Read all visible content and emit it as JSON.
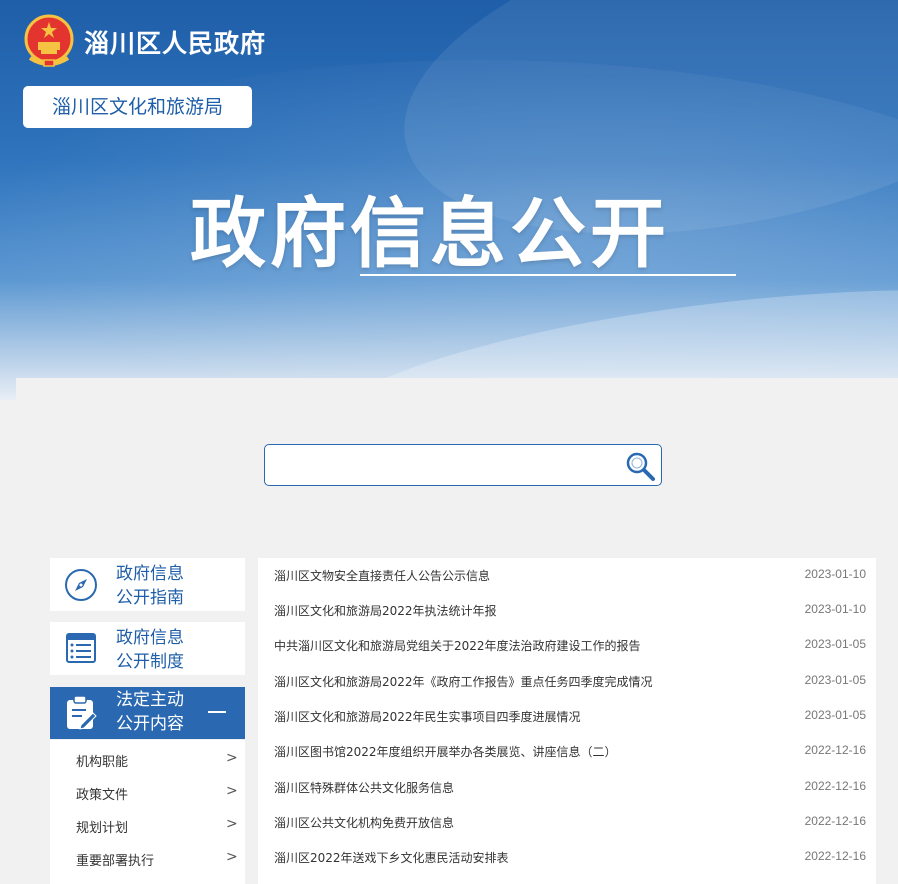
{
  "header": {
    "site_title": "淄川区人民政府",
    "department": "淄川区文化和旅游局",
    "hero_title": "政府信息公开"
  },
  "search": {
    "value": "",
    "placeholder": ""
  },
  "sidebar": {
    "cards": [
      {
        "line1": "政府信息",
        "line2": "公开指南",
        "icon": "compass-icon"
      },
      {
        "line1": "政府信息",
        "line2": "公开制度",
        "icon": "document-list-icon"
      }
    ],
    "active": {
      "line1": "法定主动",
      "line2": "公开内容",
      "icon": "clipboard-edit-icon"
    },
    "sub_items": [
      {
        "label": "机构职能"
      },
      {
        "label": "政策文件"
      },
      {
        "label": "规划计划"
      },
      {
        "label": "重要部署执行"
      }
    ]
  },
  "list": {
    "rows": [
      {
        "title": "淄川区文物安全直接责任人公告公示信息",
        "date": "2023-01-10"
      },
      {
        "title": "淄川区文化和旅游局2022年执法统计年报",
        "date": "2023-01-10"
      },
      {
        "title": "中共淄川区文化和旅游局党组关于2022年度法治政府建设工作的报告",
        "date": "2023-01-05"
      },
      {
        "title": "淄川区文化和旅游局2022年《政府工作报告》重点任务四季度完成情况",
        "date": "2023-01-05"
      },
      {
        "title": "淄川区文化和旅游局2022年民生实事项目四季度进展情况",
        "date": "2023-01-05"
      },
      {
        "title": "淄川区图书馆2022年度组织开展举办各类展览、讲座信息（二）",
        "date": "2022-12-16"
      },
      {
        "title": "淄川区特殊群体公共文化服务信息",
        "date": "2022-12-16"
      },
      {
        "title": "淄川区公共文化机构免费开放信息",
        "date": "2022-12-16"
      },
      {
        "title": "淄川区2022年送戏下乡文化惠民活动安排表",
        "date": "2022-12-16"
      }
    ]
  },
  "colors": {
    "brand_blue": "#2a69b1",
    "text": "#333333",
    "date": "#777777"
  }
}
